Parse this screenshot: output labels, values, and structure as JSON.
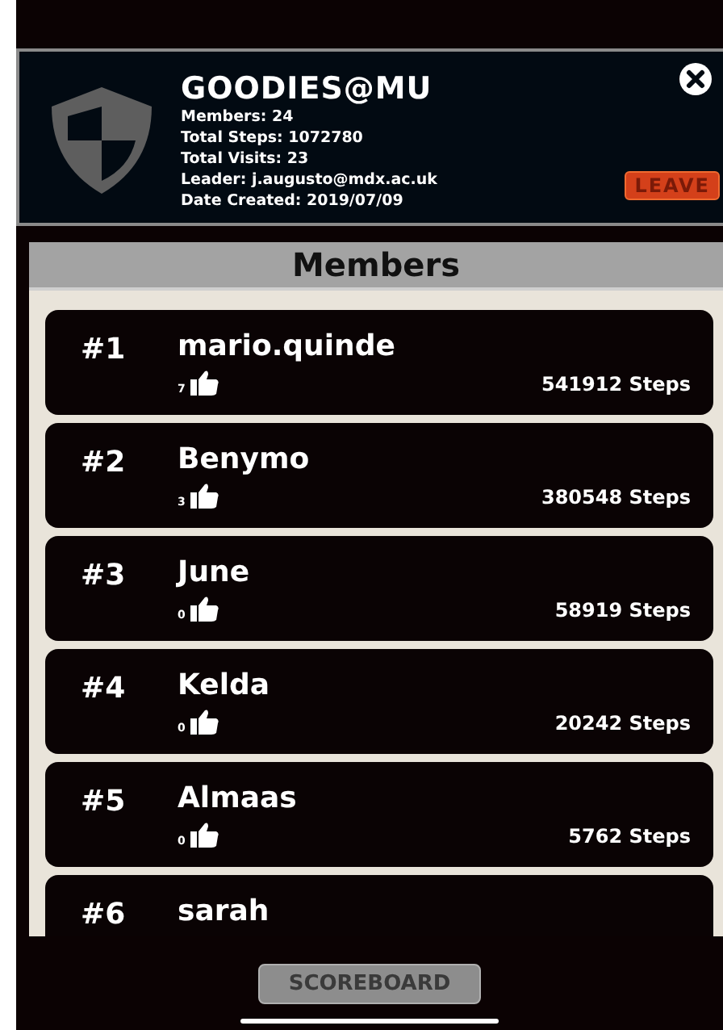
{
  "group": {
    "name": "GOODIES@MU",
    "stats": [
      "Members: 24",
      "Total Steps: 1072780",
      "Total Visits: 23",
      "Leader: j.augusto@mdx.ac.uk",
      "Date Created: 2019/07/09"
    ],
    "leave_button": "LEAVE"
  },
  "members_title": "Members",
  "members": [
    {
      "rank": "#1",
      "name": "mario.quinde",
      "likes": "7",
      "steps": "541912 Steps"
    },
    {
      "rank": "#2",
      "name": "Benymo",
      "likes": "3",
      "steps": "380548 Steps"
    },
    {
      "rank": "#3",
      "name": "June",
      "likes": "0",
      "steps": "58919 Steps"
    },
    {
      "rank": "#4",
      "name": "Kelda",
      "likes": "0",
      "steps": "20242 Steps"
    },
    {
      "rank": "#5",
      "name": "Almaas",
      "likes": "0",
      "steps": "5762 Steps"
    },
    {
      "rank": "#6",
      "name": "sarah"
    }
  ],
  "scoreboard_button": "SCOREBOARD"
}
